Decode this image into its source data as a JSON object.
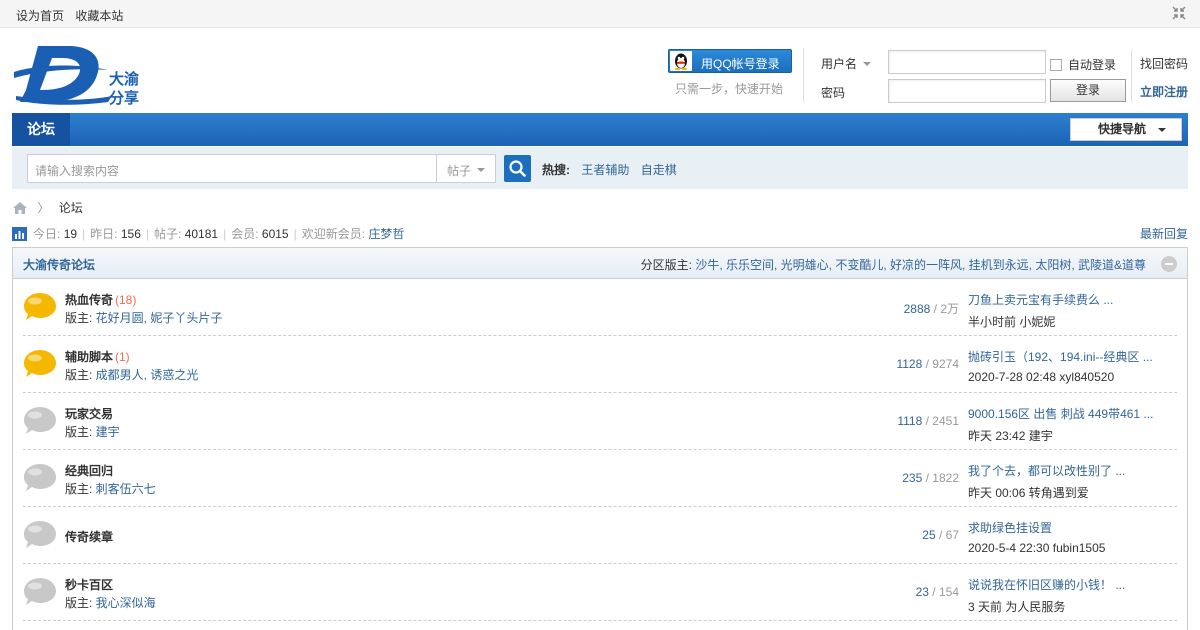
{
  "topbar": {
    "set_home": "设为首页",
    "bookmark": "收藏本站"
  },
  "header": {
    "logo_text_1": "大渝",
    "logo_text_2": "分享",
    "qq_login": "用QQ帐号登录",
    "qq_hint": "只需一步，快速开始",
    "username_label": "用户名",
    "password_label": "密码",
    "auto_login": "自动登录",
    "login_button": "登录",
    "find_password": "找回密码",
    "register": "立即注册"
  },
  "nav": {
    "tab_forum": "论坛",
    "quick_nav": "快捷导航"
  },
  "search": {
    "placeholder": "请输入搜索内容",
    "type": "帖子",
    "hot_label": "热搜:",
    "hot_terms": [
      "王者辅助",
      "自走棋"
    ]
  },
  "breadcrumb": {
    "current": "论坛"
  },
  "stats": {
    "today_label": "今日:",
    "today": "19",
    "yesterday_label": "昨日:",
    "yesterday": "156",
    "posts_label": "帖子:",
    "posts": "40181",
    "members_label": "会员:",
    "members": "6015",
    "newmember_label": "欢迎新会员:",
    "newmember": "庄梦哲",
    "latest_reply": "最新回复"
  },
  "forum": {
    "title": "大渝传奇论坛",
    "moderators_label": "分区版主:",
    "moderators": "沙牛, 乐乐空间, 光明雄心, 不变酷儿, 好凉的一阵风, 挂机到永远, 太阳树, 武陵道&道尊",
    "mods_prefix": "版主:",
    "rows": [
      {
        "name": "热血传奇",
        "today": "(18)",
        "mods": "花好月圆, 妮子丫头片子",
        "threads": "2888",
        "posts": "2万",
        "last_title": "刀鱼上卖元宝有手续费么 ...",
        "last_meta": "半小时前 小妮妮",
        "active": true
      },
      {
        "name": "辅助脚本",
        "today": "(1)",
        "mods": "成都男人, 诱惑之光",
        "threads": "1128",
        "posts": "9274",
        "last_title": "抛砖引玉（192、194.ini--经典区 ...",
        "last_meta": "2020-7-28 02:48 xyl840520",
        "active": true
      },
      {
        "name": "玩家交易",
        "today": "",
        "mods": "建宇",
        "threads": "1118",
        "posts": "2451",
        "last_title": "9000.156区 出售 刺战 449带461 ...",
        "last_meta": "昨天 23:42 建宇",
        "active": false
      },
      {
        "name": "经典回归",
        "today": "",
        "mods": "刺客伍六七",
        "threads": "235",
        "posts": "1822",
        "last_title": "我了个去，都可以改性别了 ...",
        "last_meta": "昨天 00:06 转角遇到爱",
        "active": false
      },
      {
        "name": "传奇续章",
        "today": "",
        "mods": "",
        "threads": "25",
        "posts": "67",
        "last_title": "求助绿色挂设置",
        "last_meta": "2020-5-4 22:30 fubin1505",
        "active": false
      },
      {
        "name": "秒卡百区",
        "today": "",
        "mods": "我心深似海",
        "threads": "23",
        "posts": "154",
        "last_title": "说说我在怀旧区赚的小钱！ ...",
        "last_meta": "3 天前 为人民服务",
        "active": false
      }
    ]
  },
  "colors": {
    "link": "#336699",
    "nav_blue": "#1b63b5",
    "today_red": "#f26c4f",
    "bubble_active": "#f5b800",
    "bubble_inactive": "#c8c8c8"
  }
}
